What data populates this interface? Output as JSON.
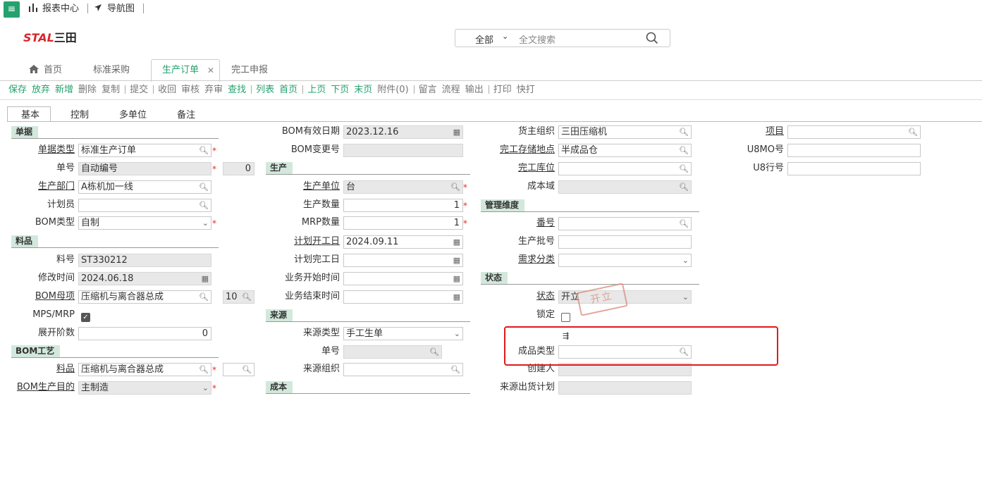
{
  "topbar": {
    "report_center": "报表中心",
    "nav_map": "导航图"
  },
  "logo": {
    "brand": "STAL",
    "company": "三田"
  },
  "search": {
    "scope": "全部",
    "placeholder": "全文搜索"
  },
  "tabs": {
    "home": "首页",
    "purchase": "标准采购",
    "production_order": "生产订单",
    "completion": "完工申报"
  },
  "toolbar": [
    {
      "label": "保存",
      "style": "green"
    },
    {
      "label": "放弃",
      "style": "green"
    },
    {
      "label": "新增",
      "style": "green"
    },
    {
      "label": "删除",
      "style": "gray"
    },
    {
      "label": "复制",
      "style": "gray"
    },
    {
      "label": "提交",
      "style": "gray"
    },
    {
      "label": "收回",
      "style": "gray"
    },
    {
      "label": "审核",
      "style": "gray"
    },
    {
      "label": "弃审",
      "style": "gray"
    },
    {
      "label": "查找",
      "style": "green"
    },
    {
      "label": "列表",
      "style": "green"
    },
    {
      "label": "首页",
      "style": "green"
    },
    {
      "label": "上页",
      "style": "green"
    },
    {
      "label": "下页",
      "style": "green"
    },
    {
      "label": "末页",
      "style": "green"
    },
    {
      "label": "附件(0)",
      "style": "gray"
    },
    {
      "label": "留言",
      "style": "gray"
    },
    {
      "label": "流程",
      "style": "gray"
    },
    {
      "label": "输出",
      "style": "gray"
    },
    {
      "label": "打印",
      "style": "gray"
    },
    {
      "label": "快打",
      "style": "gray"
    }
  ],
  "form_tabs": {
    "basic": "基本",
    "control": "控制",
    "multi_unit": "多单位",
    "remarks": "备注"
  },
  "sections": {
    "doc": "单据",
    "material": "料品",
    "bom_route": "BOM工艺",
    "production": "生产",
    "source": "来源",
    "cost": "成本",
    "mgmt": "管理维度",
    "status": "状态"
  },
  "labels": {
    "doc_type": "单据类型",
    "doc_no": "单号",
    "prod_dept": "生产部门",
    "planner": "计划员",
    "bom_type": "BOM类型",
    "item_no": "料号",
    "modified_time": "修改时间",
    "bom_parent": "BOM母项",
    "mps_mrp": "MPS/MRP",
    "expand_level": "展开阶数",
    "route_item": "料品",
    "bom_purpose": "BOM生产目的",
    "bom_eff_date": "BOM有效日期",
    "bom_change_no": "BOM变更号",
    "prod_unit": "生产单位",
    "prod_qty": "生产数量",
    "mrp_qty": "MRP数量",
    "plan_start": "计划开工日",
    "plan_finish": "计划完工日",
    "biz_start": "业务开始时间",
    "biz_end": "业务结束时间",
    "source_type": "来源类型",
    "source_no": "单号",
    "source_org": "来源组织",
    "owner_org": "货主组织",
    "finish_location": "完工存储地点",
    "finish_bin": "完工库位",
    "cost_domain": "成本域",
    "serial": "番号",
    "prod_batch": "生产批号",
    "demand_class": "需求分类",
    "status": "状态",
    "lock": "锁定",
    "product_type": "成品类型",
    "creator": "创建人",
    "source_ship_plan": "来源出货计划",
    "project": "项目",
    "u8mo": "U8MO号",
    "u8row": "U8行号"
  },
  "values": {
    "doc_type": "标准生产订单",
    "doc_no": "自动编号",
    "doc_no_seq": "0",
    "prod_dept": "A栋机加一线",
    "bom_type": "自制",
    "item_no": "ST330212",
    "modified_time": "2024.06.18",
    "bom_parent": "压缩机与离合器总成",
    "bom_parent_ver": "10",
    "expand_level": "0",
    "route_item": "压缩机与离合器总成",
    "bom_purpose": "主制造",
    "bom_eff_date": "2023.12.16",
    "prod_unit": "台",
    "prod_qty": "1",
    "mrp_qty": "1",
    "plan_start": "2024.09.11",
    "source_type": "手工生单",
    "owner_org": "三田压缩机",
    "finish_location": "半成品仓",
    "status": "开立",
    "stamp": "开立"
  },
  "colors": {
    "accent": "#23a26d",
    "section_bg": "#d3e8dc",
    "highlight": "#e01a1a",
    "required": "#d32"
  }
}
